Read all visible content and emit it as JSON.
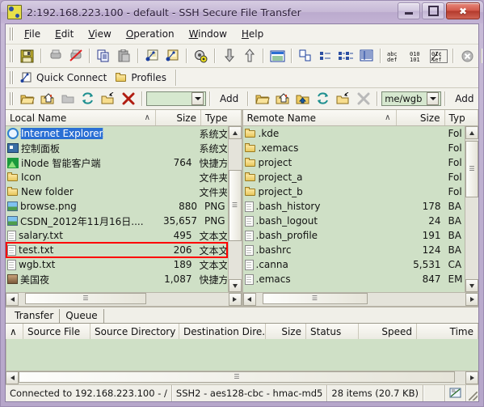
{
  "window": {
    "title": "2:192.168.223.100 - default - SSH Secure File Transfer",
    "app_icon": "ssh-file-transfer-icon",
    "minimize_label": "–",
    "maximize_label": "□",
    "close_label": "✕"
  },
  "menubar": {
    "items": [
      {
        "label": "File"
      },
      {
        "label": "Edit"
      },
      {
        "label": "View"
      },
      {
        "label": "Operation"
      },
      {
        "label": "Window"
      },
      {
        "label": "Help"
      }
    ]
  },
  "toolbar": {
    "buttons": [
      {
        "name": "save-icon"
      },
      {
        "name": "print-icon"
      },
      {
        "name": "print-disabled-icon"
      },
      {
        "name": "copy-icon"
      },
      {
        "name": "paste-icon"
      },
      {
        "name": "new-terminal-icon"
      },
      {
        "name": "new-file-transfer-icon"
      },
      {
        "name": "settings-gear-icon"
      },
      {
        "name": "download-arrow-icon"
      },
      {
        "name": "upload-arrow-icon"
      },
      {
        "name": "view-detail-icon"
      },
      {
        "name": "view-large-icons-icon"
      },
      {
        "name": "view-small-icons-icon"
      },
      {
        "name": "view-list-icon"
      },
      {
        "name": "view-details-grid-icon"
      },
      {
        "name": "ascii-transfer-icon"
      },
      {
        "name": "binary-transfer-icon"
      },
      {
        "name": "auto-transfer-icon"
      },
      {
        "name": "disconnect-icon"
      },
      {
        "name": "help-book-icon"
      },
      {
        "name": "context-help-icon"
      }
    ]
  },
  "quickbar": {
    "quick_connect": "Quick Connect",
    "profiles": "Profiles"
  },
  "navbar": {
    "local": {
      "buttons": [
        "up-folder-icon",
        "home-folder-icon",
        "folder-disabled-icon",
        "refresh-icon",
        "new-folder-icon",
        "delete-icon"
      ],
      "path_value": "",
      "add_label": "Add"
    },
    "remote": {
      "buttons": [
        "up-folder-icon",
        "home-folder-icon",
        "parent-folder-icon",
        "refresh-icon",
        "new-folder-icon",
        "delete-disabled-icon"
      ],
      "path_value": "me/wgb",
      "add_label": "Add"
    }
  },
  "local_pane": {
    "columns": [
      {
        "label": "Local Name",
        "sort": "∧"
      },
      {
        "label": "Size"
      },
      {
        "label": "Type",
        "sort": "▲"
      }
    ],
    "rows": [
      {
        "name": "Internet Explorer",
        "size": "",
        "type": "系统文",
        "icon": "ie-icon",
        "selected": true
      },
      {
        "name": "控制面板",
        "size": "",
        "type": "系统文",
        "icon": "control-panel-icon",
        "selected": false
      },
      {
        "name": "iNode 智能客户端",
        "size": "764",
        "type": "快捷方",
        "icon": "inode-icon",
        "selected": false
      },
      {
        "name": "Icon",
        "size": "",
        "type": "文件夹",
        "icon": "folder-icon",
        "selected": false
      },
      {
        "name": "New folder",
        "size": "",
        "type": "文件夹",
        "icon": "folder-icon",
        "selected": false
      },
      {
        "name": "browse.png",
        "size": "880",
        "type": "PNG",
        "icon": "png-icon",
        "selected": false
      },
      {
        "name": "CSDN_2012年11月16日....",
        "size": "35,657",
        "type": "PNG",
        "icon": "png-icon",
        "selected": false
      },
      {
        "name": "salary.txt",
        "size": "495",
        "type": "文本文",
        "icon": "text-file-icon",
        "selected": false
      },
      {
        "name": "test.txt",
        "size": "206",
        "type": "文本文",
        "icon": "text-file-icon",
        "selected": false,
        "highlighted": true
      },
      {
        "name": "wgb.txt",
        "size": "189",
        "type": "文本文",
        "icon": "text-file-icon",
        "selected": false
      },
      {
        "name": "美国夜",
        "size": "1,087",
        "type": "快捷方",
        "icon": "picture-icon",
        "selected": false
      }
    ]
  },
  "remote_pane": {
    "columns": [
      {
        "label": "Remote Name",
        "sort": "∧"
      },
      {
        "label": "Size"
      },
      {
        "label": "Typ",
        "sort": "▲"
      }
    ],
    "rows": [
      {
        "name": ".kde",
        "size": "",
        "type": "Fol",
        "icon": "folder-icon"
      },
      {
        "name": ".xemacs",
        "size": "",
        "type": "Fol",
        "icon": "folder-icon"
      },
      {
        "name": "project",
        "size": "",
        "type": "Fol",
        "icon": "folder-icon"
      },
      {
        "name": "project_a",
        "size": "",
        "type": "Fol",
        "icon": "folder-icon"
      },
      {
        "name": "project_b",
        "size": "",
        "type": "Fol",
        "icon": "folder-icon"
      },
      {
        "name": ".bash_history",
        "size": "178",
        "type": "BA",
        "icon": "file-icon"
      },
      {
        "name": ".bash_logout",
        "size": "24",
        "type": "BA",
        "icon": "file-icon"
      },
      {
        "name": ".bash_profile",
        "size": "191",
        "type": "BA",
        "icon": "file-icon"
      },
      {
        "name": ".bashrc",
        "size": "124",
        "type": "BA",
        "icon": "file-icon"
      },
      {
        "name": ".canna",
        "size": "5,531",
        "type": "CA",
        "icon": "file-icon"
      },
      {
        "name": ".emacs",
        "size": "847",
        "type": "EM",
        "icon": "file-icon"
      }
    ]
  },
  "transfer_panel": {
    "tabs": [
      {
        "label": "Transfer",
        "active": true
      },
      {
        "label": "Queue",
        "active": false
      }
    ],
    "columns": [
      {
        "label": "∧"
      },
      {
        "label": "Source File"
      },
      {
        "label": "Source Directory"
      },
      {
        "label": "Destination Dire..."
      },
      {
        "label": "Size"
      },
      {
        "label": "Status"
      },
      {
        "label": "Speed"
      },
      {
        "label": "Time"
      }
    ],
    "rows": []
  },
  "statusbar": {
    "connection": "Connected to 192.168.223.100 - /",
    "cipher": "SSH2 - aes128-cbc - hmac-md5",
    "items": "28 items (20.7 KB)",
    "spacer": "",
    "indicator_icon": "transfer-indicator-icon"
  },
  "colors": {
    "list_background": "#cfe0c6",
    "selection": "#2a6fd4",
    "highlight_box": "#ff0000",
    "title_gradient_start": "#d7cde2",
    "title_gradient_end": "#c3b3d4"
  }
}
